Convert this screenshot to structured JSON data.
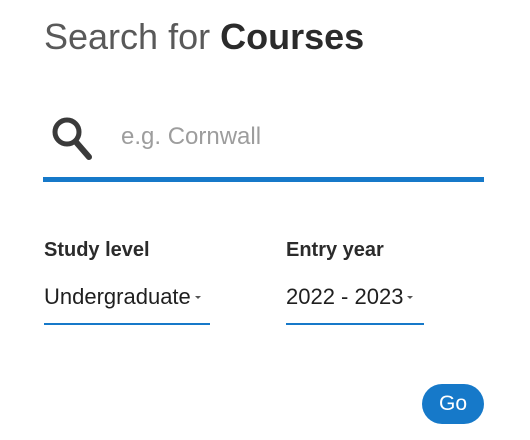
{
  "header": {
    "title_prefix": "Search for",
    "title_emphasis": "Courses"
  },
  "search": {
    "icon": "search-icon",
    "placeholder": "e.g. Cornwall",
    "value": ""
  },
  "filters": {
    "study_level": {
      "label": "Study level",
      "selected": "Undergraduate",
      "icon": "caret-down-icon"
    },
    "entry_year": {
      "label": "Entry year",
      "selected": "2022 - 2023",
      "icon": "caret-down-icon"
    }
  },
  "actions": {
    "go_label": "Go"
  },
  "colors": {
    "accent": "#1679c9",
    "text": "#2b2b2b",
    "placeholder": "#9d9d9d"
  }
}
